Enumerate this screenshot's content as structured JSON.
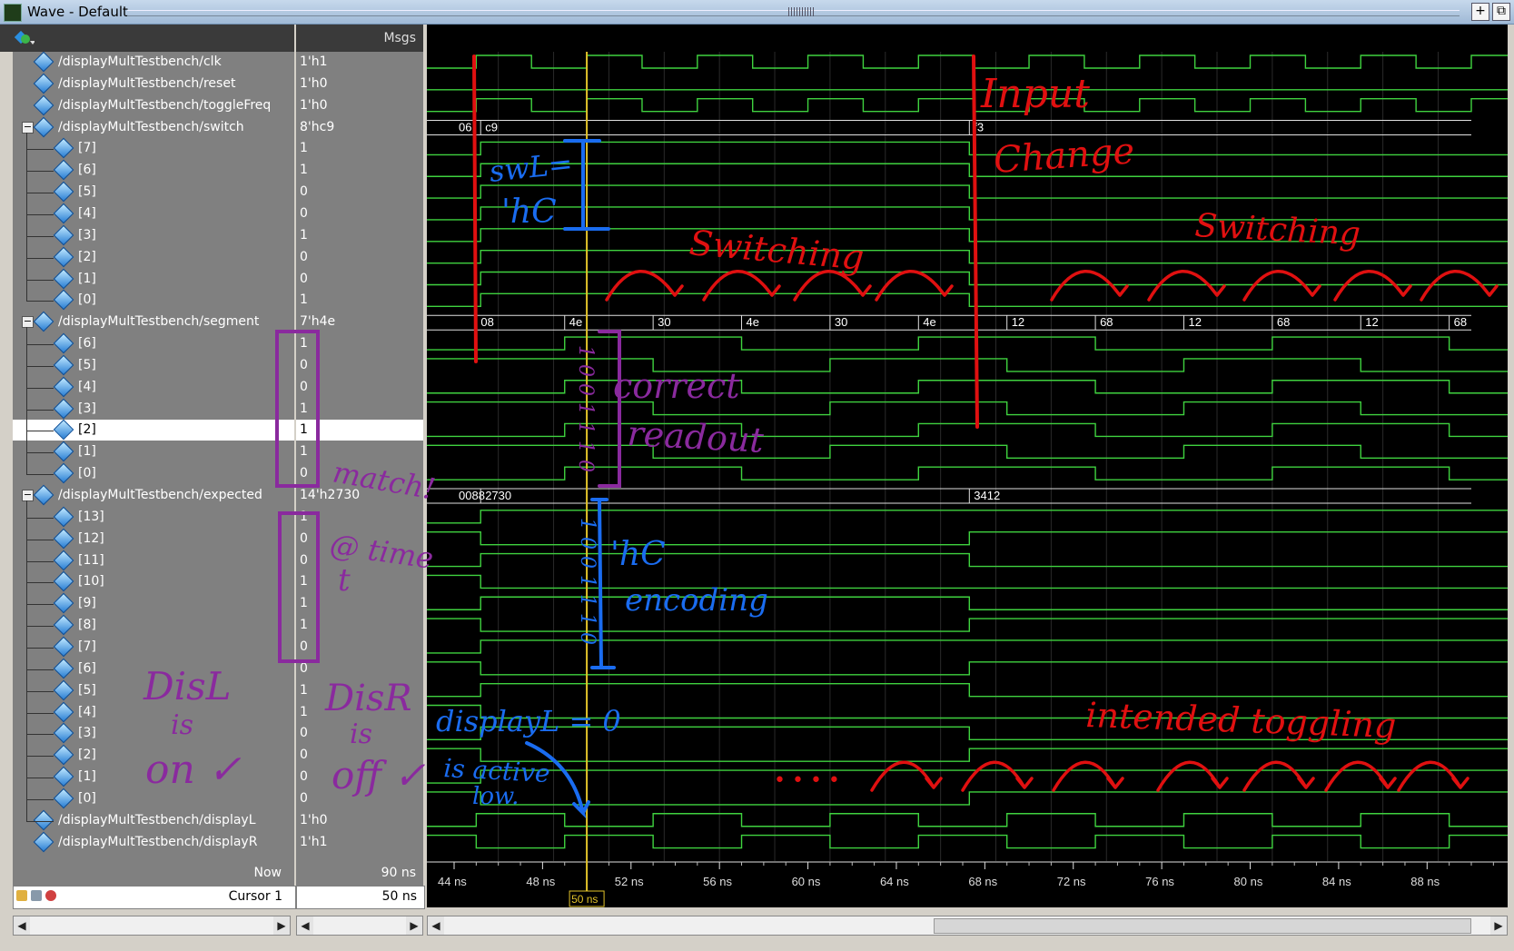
{
  "window": {
    "title": "Wave - Default",
    "btn_add": "+",
    "btn_float": "⧉"
  },
  "header": {
    "msgs": "Msgs"
  },
  "signals": [
    {
      "name": "/displayMultTestbench/clk",
      "msg": "1'h1",
      "level": 0
    },
    {
      "name": "/displayMultTestbench/reset",
      "msg": "1'h0",
      "level": 0
    },
    {
      "name": "/displayMultTestbench/toggleFreq",
      "msg": "1'h0",
      "level": 0
    },
    {
      "name": "/displayMultTestbench/switch",
      "msg": "8'hc9",
      "level": 0,
      "expanded": true
    },
    {
      "name": "[7]",
      "msg": "1",
      "level": 1
    },
    {
      "name": "[6]",
      "msg": "1",
      "level": 1
    },
    {
      "name": "[5]",
      "msg": "0",
      "level": 1
    },
    {
      "name": "[4]",
      "msg": "0",
      "level": 1
    },
    {
      "name": "[3]",
      "msg": "1",
      "level": 1
    },
    {
      "name": "[2]",
      "msg": "0",
      "level": 1
    },
    {
      "name": "[1]",
      "msg": "0",
      "level": 1
    },
    {
      "name": "[0]",
      "msg": "1",
      "level": 1
    },
    {
      "name": "/displayMultTestbench/segment",
      "msg": "7'h4e",
      "level": 0,
      "expanded": true
    },
    {
      "name": "[6]",
      "msg": "1",
      "level": 1
    },
    {
      "name": "[5]",
      "msg": "0",
      "level": 1
    },
    {
      "name": "[4]",
      "msg": "0",
      "level": 1
    },
    {
      "name": "[3]",
      "msg": "1",
      "level": 1
    },
    {
      "name": "[2]",
      "msg": "1",
      "level": 1,
      "selected": true
    },
    {
      "name": "[1]",
      "msg": "1",
      "level": 1
    },
    {
      "name": "[0]",
      "msg": "0",
      "level": 1
    },
    {
      "name": "/displayMultTestbench/expected",
      "msg": "14'h2730",
      "level": 0,
      "expanded": true
    },
    {
      "name": "[13]",
      "msg": "1",
      "level": 1
    },
    {
      "name": "[12]",
      "msg": "0",
      "level": 1
    },
    {
      "name": "[11]",
      "msg": "0",
      "level": 1
    },
    {
      "name": "[10]",
      "msg": "1",
      "level": 1
    },
    {
      "name": "[9]",
      "msg": "1",
      "level": 1
    },
    {
      "name": "[8]",
      "msg": "1",
      "level": 1
    },
    {
      "name": "[7]",
      "msg": "0",
      "level": 1
    },
    {
      "name": "[6]",
      "msg": "0",
      "level": 1
    },
    {
      "name": "[5]",
      "msg": "1",
      "level": 1
    },
    {
      "name": "[4]",
      "msg": "1",
      "level": 1
    },
    {
      "name": "[3]",
      "msg": "0",
      "level": 1
    },
    {
      "name": "[2]",
      "msg": "0",
      "level": 1
    },
    {
      "name": "[1]",
      "msg": "0",
      "level": 1
    },
    {
      "name": "[0]",
      "msg": "0",
      "level": 1
    },
    {
      "name": "/displayMultTestbench/displayL",
      "msg": "1'h0",
      "level": 0
    },
    {
      "name": "/displayMultTestbench/displayR",
      "msg": "1'h1",
      "level": 0
    }
  ],
  "bus_labels": {
    "switch": [
      {
        "t": 44,
        "v": "06"
      },
      {
        "t": 45.2,
        "v": "c9"
      },
      {
        "t": 67.3,
        "v": "f3"
      }
    ],
    "segment": [
      {
        "t": 45.0,
        "v": "08"
      },
      {
        "t": 49.0,
        "v": "4e"
      },
      {
        "t": 53.0,
        "v": "30"
      },
      {
        "t": 57.0,
        "v": "4e"
      },
      {
        "t": 61.0,
        "v": "30"
      },
      {
        "t": 65.0,
        "v": "4e"
      },
      {
        "t": 69.0,
        "v": "12"
      },
      {
        "t": 73.0,
        "v": "68"
      },
      {
        "t": 77.0,
        "v": "12"
      },
      {
        "t": 81.0,
        "v": "68"
      },
      {
        "t": 85.0,
        "v": "12"
      },
      {
        "t": 89.0,
        "v": "68"
      }
    ],
    "expected": [
      {
        "t": 44,
        "v": "0088"
      },
      {
        "t": 45.2,
        "v": "2730"
      },
      {
        "t": 67.3,
        "v": "3412"
      }
    ]
  },
  "status": {
    "now_label": "Now",
    "now_value": "90 ns",
    "cursor_label": "Cursor 1",
    "cursor_value": "50 ns",
    "cursor_flag": "50 ns",
    "time_ticks": [
      "44 ns",
      "48 ns",
      "52 ns",
      "56 ns",
      "60 ns",
      "64 ns",
      "68 ns",
      "72 ns",
      "76 ns",
      "80 ns",
      "84 ns",
      "88 ns"
    ]
  },
  "annotations": {
    "input_change": "Input",
    "input_change2": "Change",
    "switching1": "Switching",
    "switching2": "Switching",
    "swl1": "swL=",
    "swl2": "'hC",
    "correct1": "correct",
    "correct2": "readout",
    "match1": "match!",
    "match2": "@ time",
    "match3": "t",
    "hc1": "'hC",
    "hc2": "encoding",
    "segbits": "1 0 0 1 1 1 0",
    "encbits": "1 0 0 1 1 1 0",
    "displ1": "displayL = 0",
    "displ2": "is active",
    "displ3": "low.",
    "disl1": "DisL",
    "disl2": "is",
    "disl3": "on ✓",
    "disr1": "DisR",
    "disr2": "is",
    "disr3": "off ✓",
    "intended": "intended toggling",
    "dots": "• • • •"
  },
  "colors": {
    "wave": "#3fd23f",
    "cursor": "#e2c32a",
    "red": "#e01010",
    "blue": "#1a6cf0",
    "purple": "#8a2a9e"
  }
}
